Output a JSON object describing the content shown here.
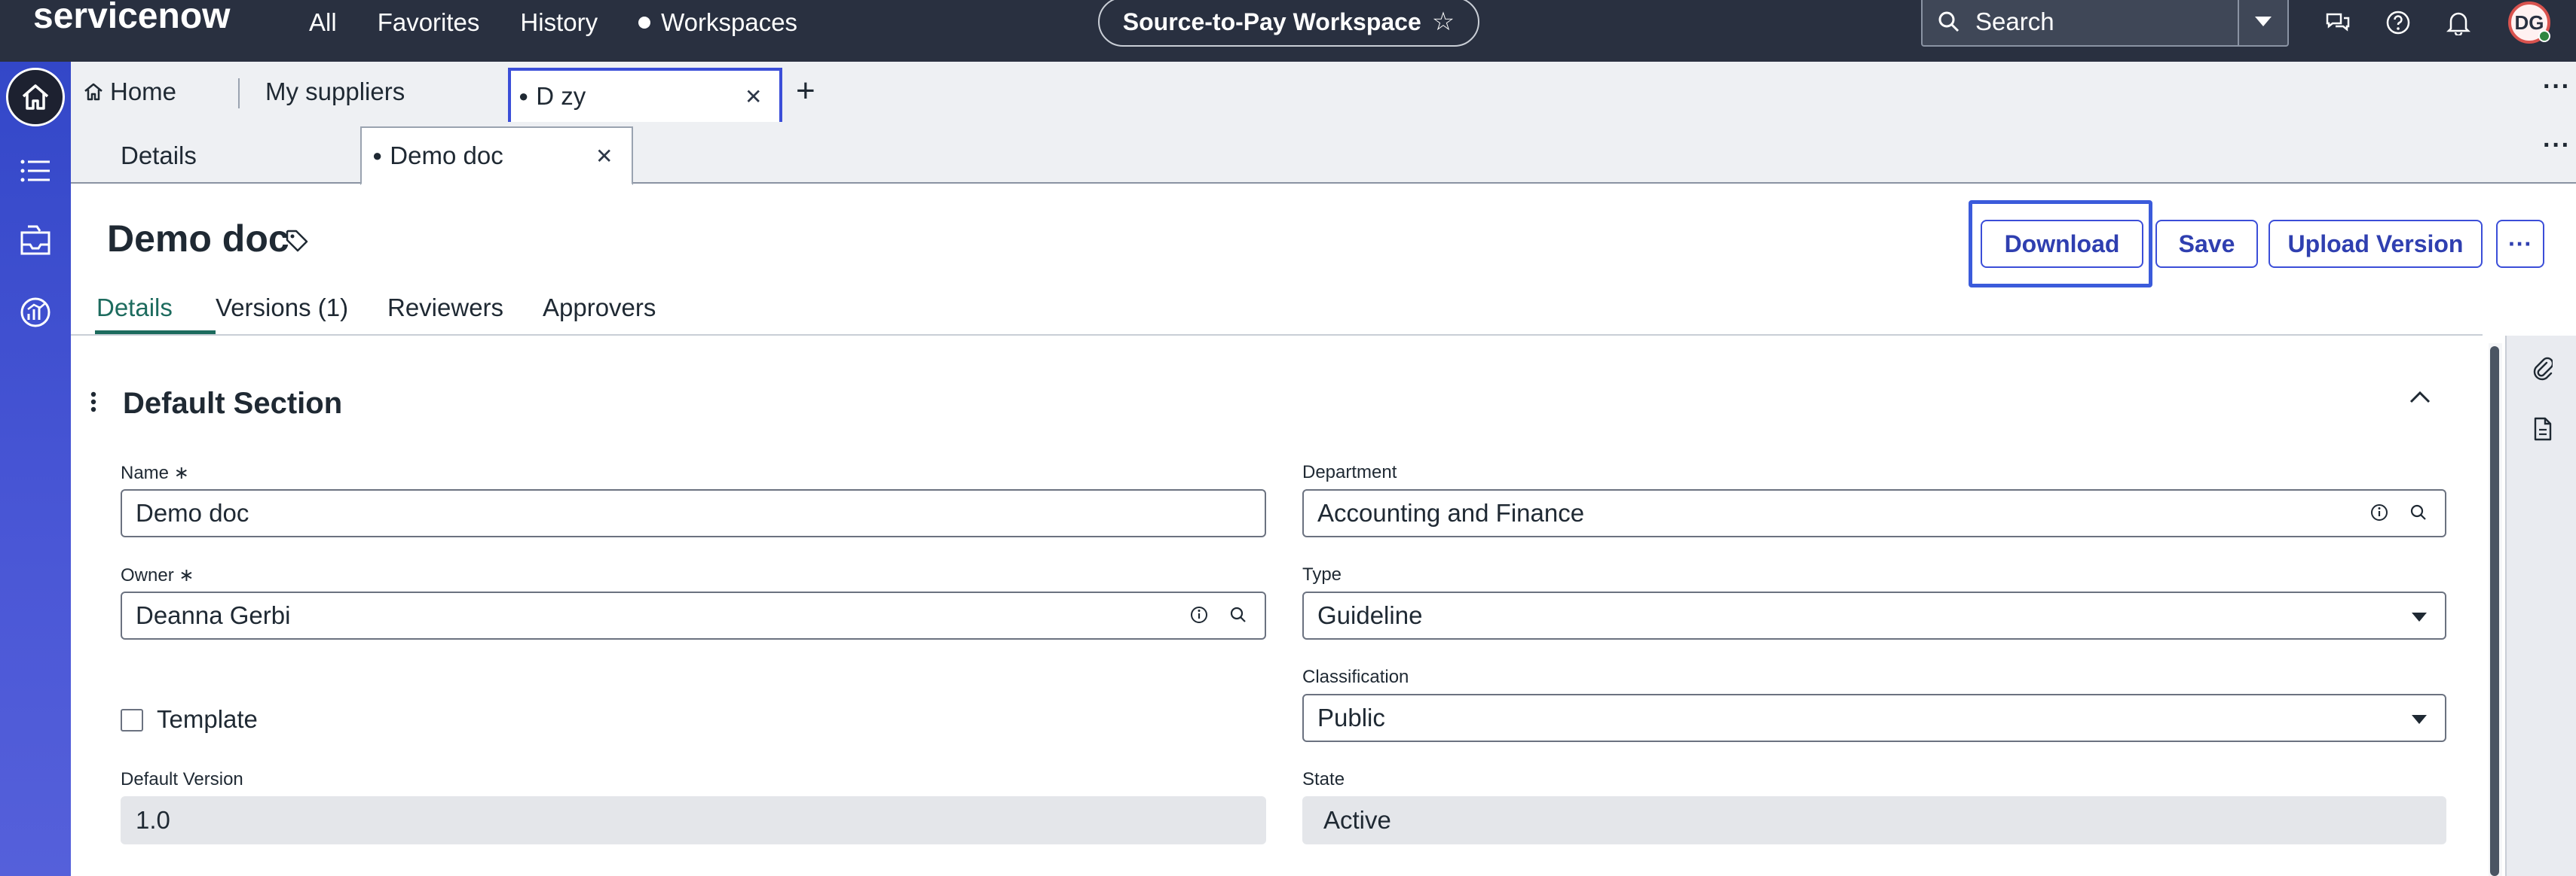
{
  "header": {
    "logo": "servicenow",
    "nav": {
      "all": "All",
      "favorites": "Favorites",
      "history": "History",
      "workspaces": "Workspaces"
    },
    "workspace_name": "Source-to-Pay Workspace",
    "search_placeholder": "Search",
    "avatar_initials": "DG",
    "icons": [
      "chat-icon",
      "help-icon",
      "bell-icon"
    ]
  },
  "rail": {
    "icons": [
      "home-icon",
      "list-icon",
      "inbox-icon",
      "analytics-icon"
    ]
  },
  "tabs_primary": [
    {
      "label": "Home"
    },
    {
      "label": "My suppliers"
    },
    {
      "label": "D     zy"
    }
  ],
  "tabs_secondary": [
    {
      "label": "Details"
    },
    {
      "label": "Demo doc"
    }
  ],
  "record": {
    "title": "Demo doc",
    "actions": {
      "download": "Download",
      "save": "Save",
      "upload_version": "Upload Version",
      "more": "···"
    },
    "subtabs": [
      "Details",
      "Versions (1)",
      "Reviewers",
      "Approvers"
    ]
  },
  "form": {
    "section_title": "Default Section",
    "name": {
      "label": "Name",
      "value": "Demo doc"
    },
    "owner": {
      "label": "Owner",
      "value": "Deanna Gerbi"
    },
    "template": {
      "label": "Template",
      "checked": false
    },
    "default_version": {
      "label": "Default Version",
      "value": "1.0"
    },
    "department": {
      "label": "Department",
      "value": "Accounting and Finance"
    },
    "type": {
      "label": "Type",
      "value": "Guideline"
    },
    "classification": {
      "label": "Classification",
      "value": "Public"
    },
    "state": {
      "label": "State",
      "value": "Active"
    },
    "required_mark": "∗"
  },
  "colors": {
    "header_bg": "#293040",
    "rail": "#3b4ed8",
    "accent_tab": "#1d6b5e",
    "button": "#3b4ed8"
  }
}
